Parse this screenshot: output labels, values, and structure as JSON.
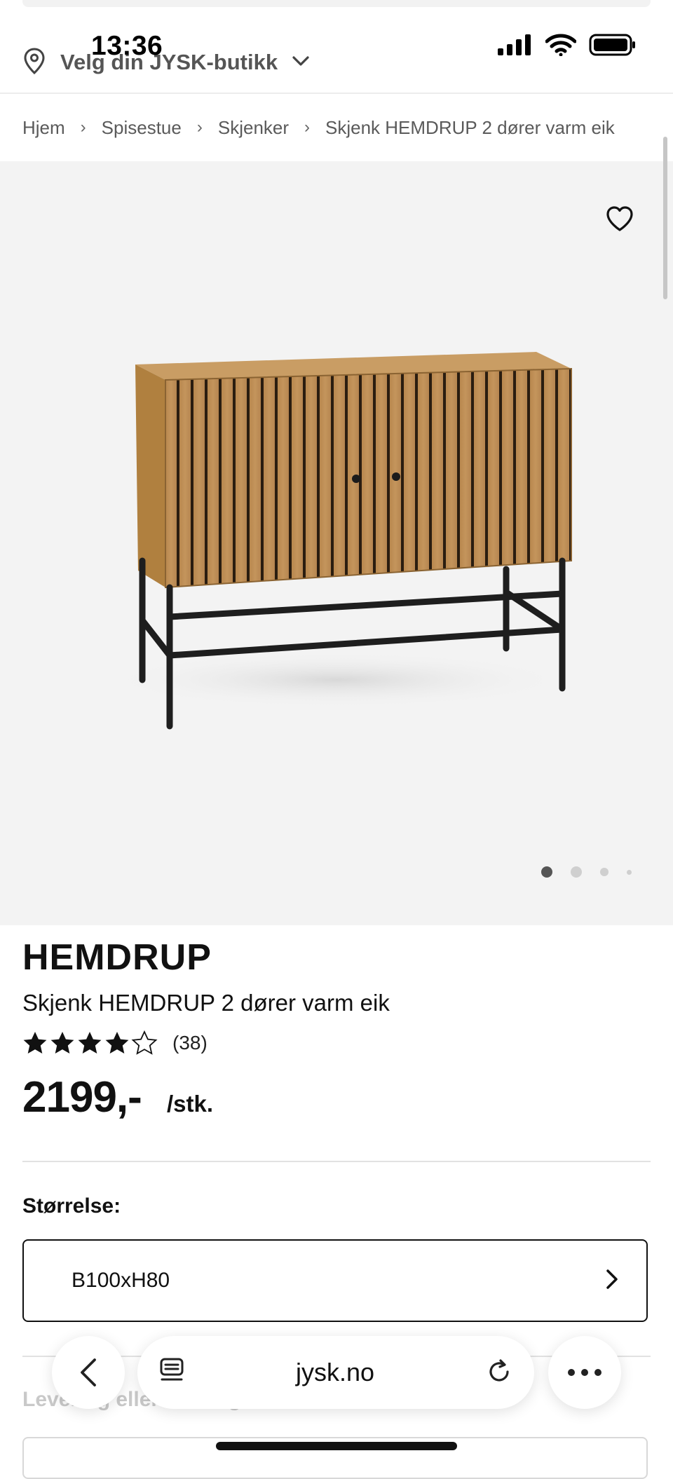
{
  "status_bar": {
    "time": "13:36"
  },
  "store_selector": {
    "label": "Velg din JYSK-butikk"
  },
  "breadcrumb": [
    "Hjem",
    "Spisestue",
    "Skjenker",
    "Skjenk HEMDRUP 2 dører varm eik"
  ],
  "gallery": {
    "active_index": 0,
    "count": 4
  },
  "product": {
    "brand": "HEMDRUP",
    "name": "Skjenk HEMDRUP 2 dører varm eik",
    "rating_value": 4.5,
    "rating_count": "(38)",
    "price": "2199,-",
    "unit": "/stk."
  },
  "size": {
    "label": "Størrelse:",
    "value": "B100xH80"
  },
  "delivery": {
    "label": "Levering eller henting:"
  },
  "browser": {
    "url": "jysk.no"
  }
}
